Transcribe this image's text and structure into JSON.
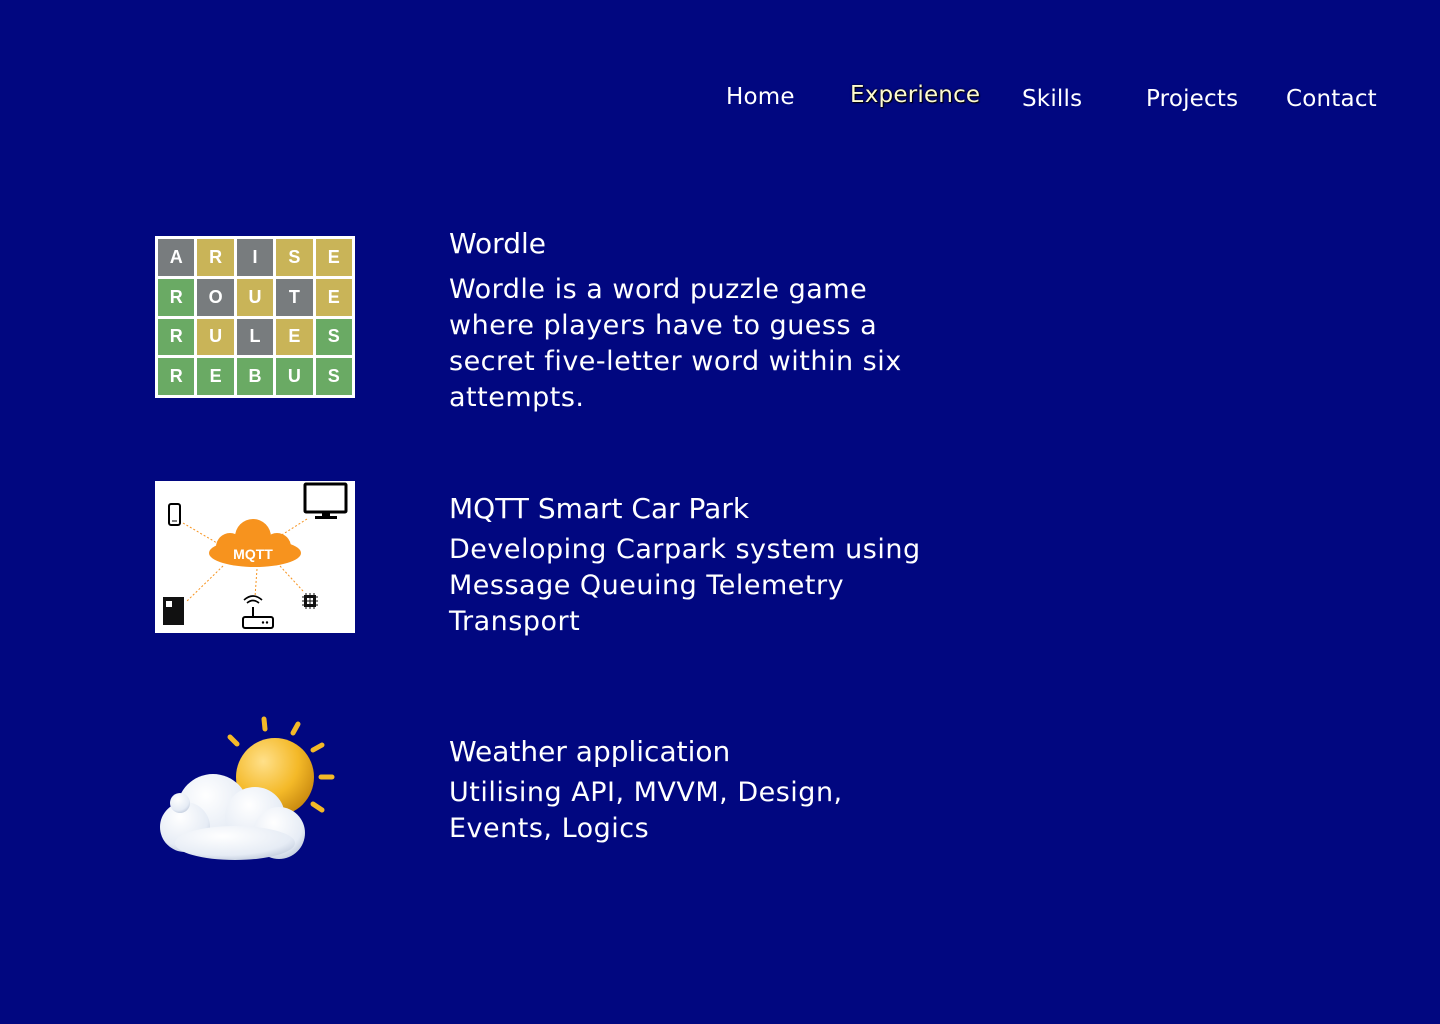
{
  "nav": {
    "home": "Home",
    "experience": "Experience",
    "skills": "Skills",
    "projects": "Projects",
    "contact": "Contact"
  },
  "projects": [
    {
      "title": "Wordle",
      "description": "Wordle is a word puzzle game where players have to guess a secret five-letter word within six attempts.",
      "image": "wordle-grid-image",
      "grid": [
        [
          {
            "l": "A",
            "s": "grey"
          },
          {
            "l": "R",
            "s": "yellow"
          },
          {
            "l": "I",
            "s": "grey"
          },
          {
            "l": "S",
            "s": "yellow"
          },
          {
            "l": "E",
            "s": "yellow"
          }
        ],
        [
          {
            "l": "R",
            "s": "green"
          },
          {
            "l": "O",
            "s": "grey"
          },
          {
            "l": "U",
            "s": "yellow"
          },
          {
            "l": "T",
            "s": "grey"
          },
          {
            "l": "E",
            "s": "yellow"
          }
        ],
        [
          {
            "l": "R",
            "s": "green"
          },
          {
            "l": "U",
            "s": "yellow"
          },
          {
            "l": "L",
            "s": "grey"
          },
          {
            "l": "E",
            "s": "yellow"
          },
          {
            "l": "S",
            "s": "green"
          }
        ],
        [
          {
            "l": "R",
            "s": "green"
          },
          {
            "l": "E",
            "s": "green"
          },
          {
            "l": "B",
            "s": "green"
          },
          {
            "l": "U",
            "s": "green"
          },
          {
            "l": "S",
            "s": "green"
          }
        ]
      ]
    },
    {
      "title": "MQTT Smart Car Park",
      "description": "Developing Carpark system using Message Queuing Telemetry Transport",
      "image": "mqtt-diagram-image",
      "cloud_label": "MQTT"
    },
    {
      "title": "Weather application",
      "description": "Utilising API, MVVM, Design, Events, Logics",
      "image": "sun-cloud-image"
    }
  ],
  "colors": {
    "background": "#010780",
    "text": "#ffffff",
    "active_nav": "#fdfbd0",
    "tile_green": "#6aaa64",
    "tile_yellow": "#c9b458",
    "tile_grey": "#787c7e",
    "mqtt_orange": "#f7931e"
  }
}
